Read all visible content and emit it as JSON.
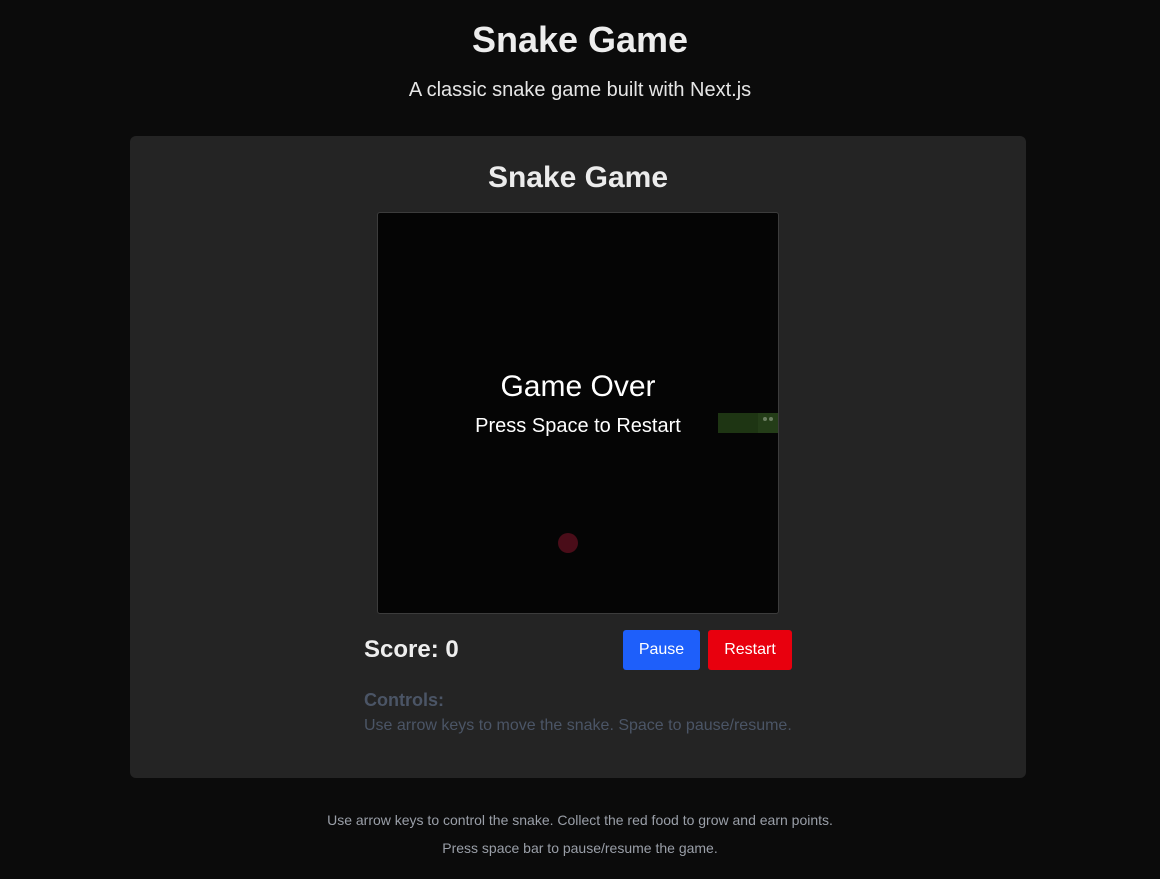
{
  "header": {
    "title": "Snake Game",
    "subtitle": "A classic snake game built with Next.js"
  },
  "game": {
    "title": "Snake Game",
    "overlay_title": "Game Over",
    "overlay_subtitle": "Press Space to Restart",
    "score_label": "Score: 0",
    "score": 0,
    "pause_label": "Pause",
    "restart_label": "Restart",
    "controls_heading": "Controls:",
    "controls_text": "Use arrow keys to move the snake. Space to pause/resume."
  },
  "footer": {
    "line1": "Use arrow keys to control the snake. Collect the red food to grow and earn points.",
    "line2": "Press space bar to pause/resume the game."
  },
  "colors": {
    "accent_pause": "#1e5ffa",
    "accent_restart": "#e8000e",
    "snake": "#243d18",
    "food": "#4a0d19"
  }
}
